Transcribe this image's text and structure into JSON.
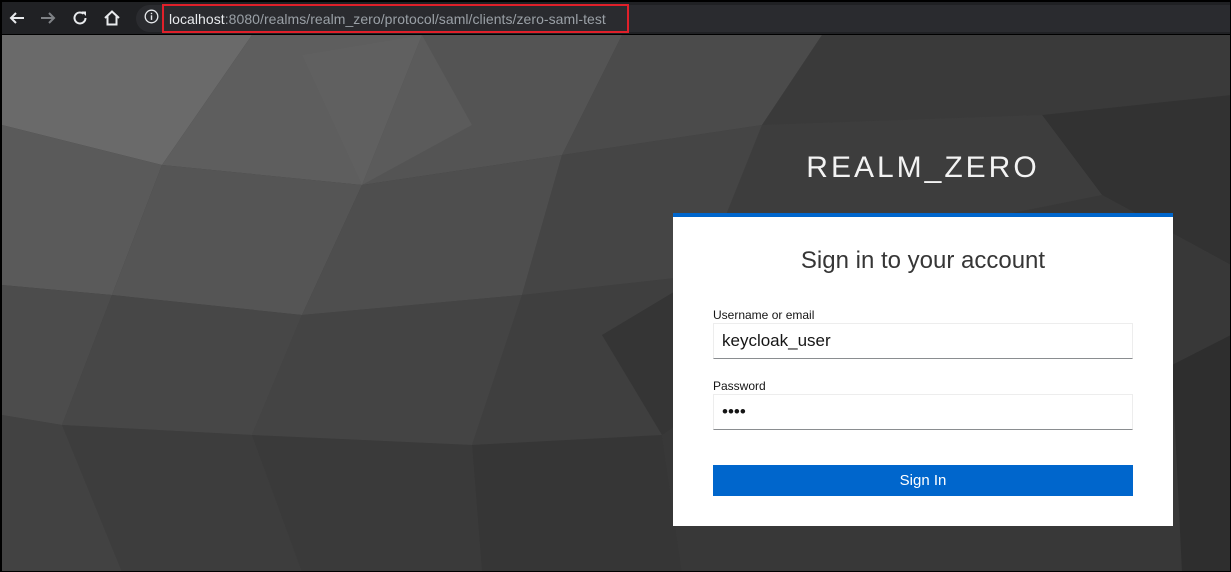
{
  "browser": {
    "url_host": "localhost",
    "url_rest": ":8080/realms/realm_zero/protocol/saml/clients/zero-saml-test",
    "icons": [
      "back-arrow-icon",
      "forward-arrow-icon",
      "reload-icon",
      "home-icon",
      "info-icon"
    ]
  },
  "login": {
    "realm_name": "REALM_ZERO",
    "heading": "Sign in to your account",
    "username_label": "Username or email",
    "username_value": "keycloak_user",
    "password_label": "Password",
    "password_value": "••••",
    "submit_label": "Sign In"
  },
  "colors": {
    "accent": "#0066cc",
    "highlight_border": "#e0202a",
    "toolbar_bg": "#202124"
  }
}
